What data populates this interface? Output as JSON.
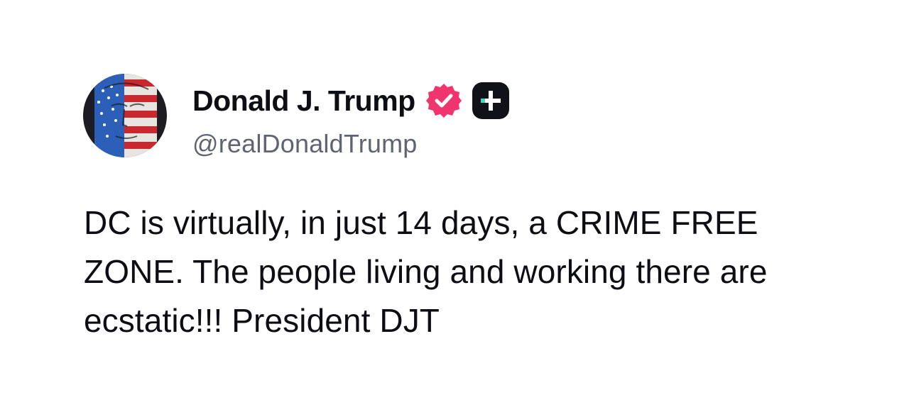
{
  "post": {
    "author": {
      "display_name": "Donald J. Trump",
      "handle": "@realDonaldTrump",
      "verified_icon": "verified-badge-icon",
      "plus_icon": "plus-badge-icon",
      "avatar_icon": "profile-avatar"
    },
    "text": "DC is virtually, in just 14 days, a CRIME FREE ZONE. The people living and working there are ecstatic!!! President DJT"
  },
  "colors": {
    "verified_badge": "#f0356e",
    "plus_badge_bg": "#111118",
    "plus_badge_accent": "#3ddbc4",
    "handle_text": "#5f6472",
    "body_text": "#0d0d14"
  }
}
